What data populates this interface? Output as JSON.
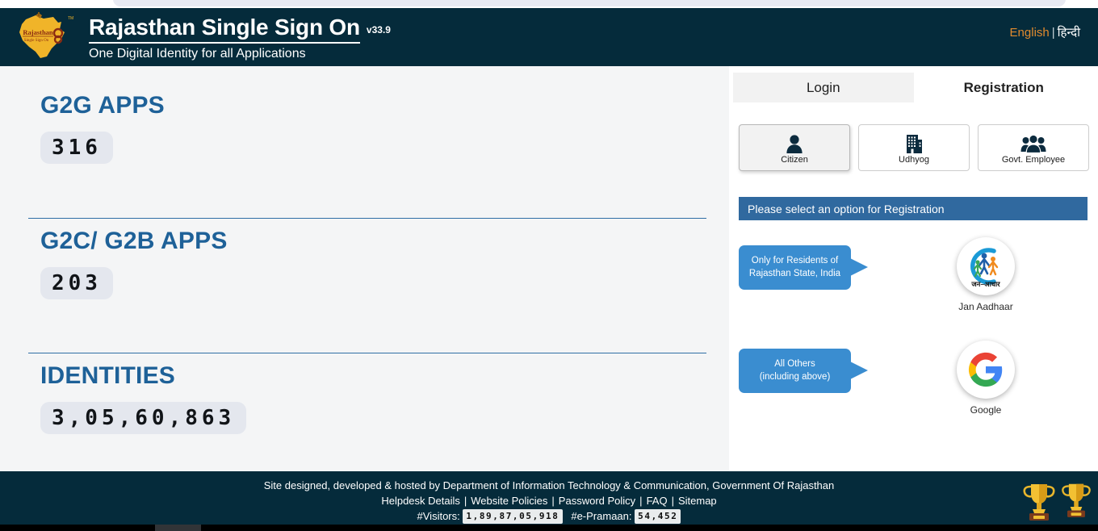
{
  "header": {
    "logo_icon": "rajasthan-state-map-logo",
    "title": "Rajasthan Single Sign On",
    "version": "v33.9",
    "subtitle": "One Digital Identity for all Applications",
    "lang_english": "English",
    "lang_separator": "|",
    "lang_hindi": "हिन्दी",
    "accent_orange": "#e08a2e",
    "bg_color": "#052b3b"
  },
  "stats": [
    {
      "title": "G2G APPS",
      "value": "316"
    },
    {
      "title": "G2C/ G2B APPS",
      "value": "203"
    },
    {
      "title": "IDENTITIES",
      "value": "3,05,60,863"
    }
  ],
  "panel": {
    "tabs": [
      {
        "label": "Login",
        "active": false
      },
      {
        "label": "Registration",
        "active": true
      }
    ],
    "option_cards": [
      {
        "label": "Citizen",
        "icon": "person-icon",
        "selected": true
      },
      {
        "label": "Udhyog",
        "icon": "building-icon",
        "selected": false
      },
      {
        "label": "Govt. Employee",
        "icon": "group-people-icon",
        "selected": false
      }
    ],
    "banner": "Please select an option for Registration",
    "banner_color": "#30699f",
    "providers": [
      {
        "callout_line1": "Only for Residents of",
        "callout_line2": "Rajasthan State, India",
        "name": "Jan Aadhaar",
        "icon": "jan-aadhaar-logo",
        "logo_text": "जन–आधार"
      },
      {
        "callout_line1": "All Others",
        "callout_line2": "(including above)",
        "name": "Google",
        "icon": "google-g-logo"
      }
    ],
    "callout_color": "#3a8dd0"
  },
  "footer": {
    "line1": "Site designed, developed & hosted by Department of Information Technology & Communication, Government Of Rajasthan",
    "links": [
      "Helpdesk Details",
      "Website Policies",
      "Password Policy",
      "FAQ",
      "Sitemap"
    ],
    "visitors_label": "#Visitors:",
    "visitors_value": "1,89,87,05,918",
    "epramaan_label": "#e-Pramaan:",
    "epramaan_value": "54,452",
    "trophy_icon": "trophy-icon"
  }
}
